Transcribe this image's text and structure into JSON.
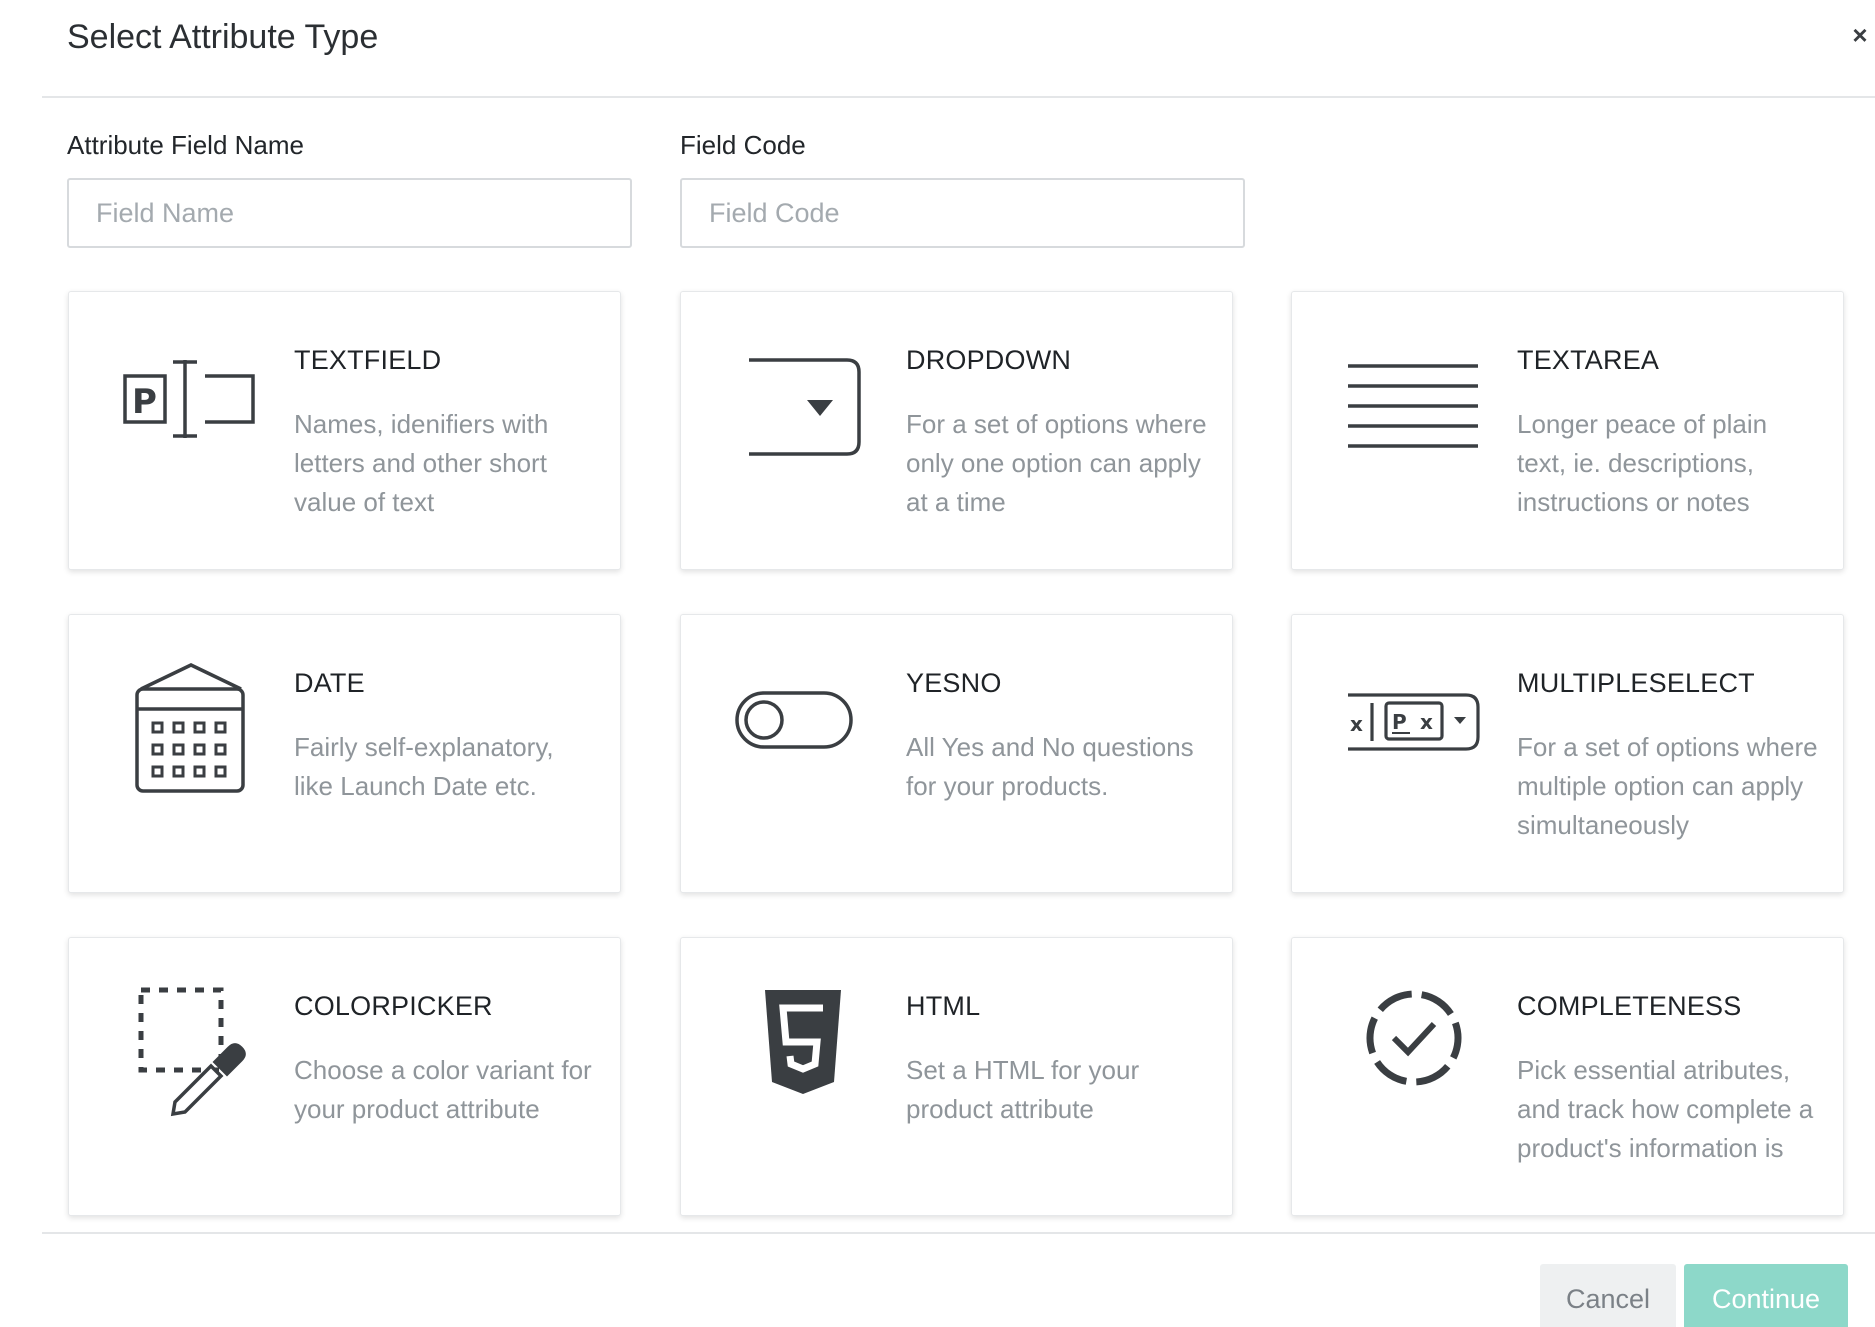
{
  "modal": {
    "title": "Select Attribute Type",
    "close_label": "×"
  },
  "fields": {
    "name": {
      "label": "Attribute Field Name",
      "placeholder": "Field Name",
      "value": ""
    },
    "code": {
      "label": "Field Code",
      "placeholder": "Field Code",
      "value": ""
    }
  },
  "types": [
    {
      "title": "TEXTFIELD",
      "description": "Names, idenifiers with\nletters and other short\nvalue of text",
      "icon": "textfield-icon"
    },
    {
      "title": "DROPDOWN",
      "description": "For a set of options where\nonly one option can apply\nat a time",
      "icon": "dropdown-icon"
    },
    {
      "title": "TEXTAREA",
      "description": "Longer peace of plain\ntext, ie. descriptions,\ninstructions or notes",
      "icon": "textarea-icon"
    },
    {
      "title": "DATE",
      "description": "Fairly self-explanatory,\nlike Launch Date etc.",
      "icon": "calendar-icon"
    },
    {
      "title": "YESNO",
      "description": "All Yes and No questions\nfor your products.",
      "icon": "toggle-icon"
    },
    {
      "title": "MULTIPLESELECT",
      "description": "For a set of options where\nmultiple option can apply\nsimultaneously",
      "icon": "multiselect-icon"
    },
    {
      "title": "COLORPICKER",
      "description": "Choose a color variant for\nyour product attribute",
      "icon": "colorpicker-icon"
    },
    {
      "title": "HTML",
      "description": "Set a HTML for your\nproduct attribute",
      "icon": "html5-icon"
    },
    {
      "title": "COMPLETENESS",
      "description": "Pick essential atributes,\nand track how complete a\nproduct's information is",
      "icon": "completeness-icon"
    }
  ],
  "footer": {
    "cancel_label": "Cancel",
    "continue_label": "Continue"
  },
  "colors": {
    "accent": "#8dd8c9",
    "title_text": "#2b2f33",
    "muted_text": "#8f959a",
    "icon_stroke": "#3a3e42"
  }
}
